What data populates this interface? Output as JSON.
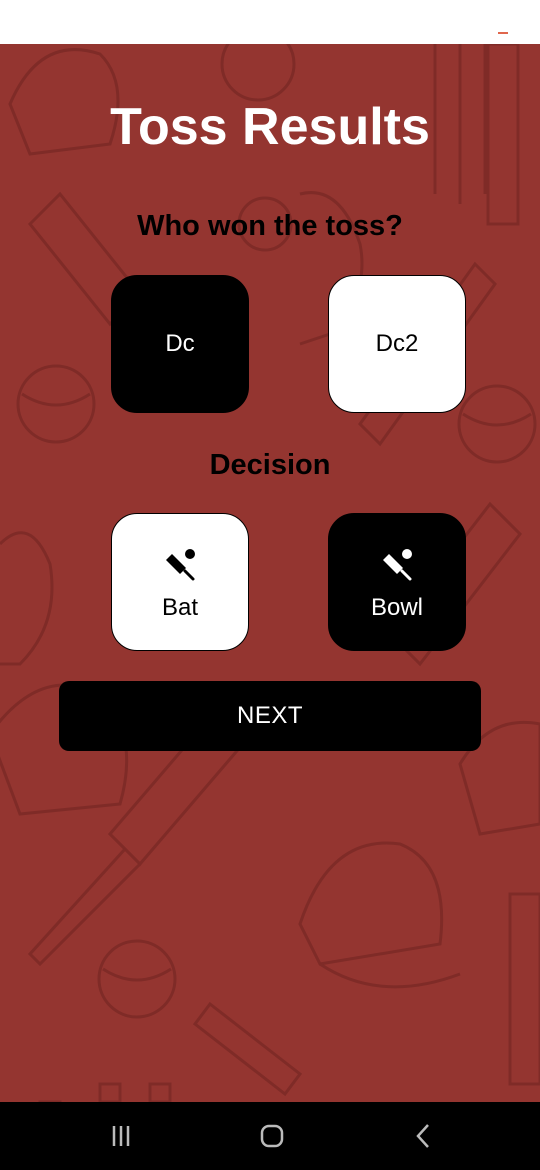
{
  "screen": {
    "title": "Toss Results",
    "toss_question": "Who won the toss?",
    "decision_label": "Decision"
  },
  "teams": [
    {
      "label": "Dc",
      "selected": true
    },
    {
      "label": "Dc2",
      "selected": false
    }
  ],
  "decisions": [
    {
      "label": "Bat",
      "icon": "cricket-bat-ball-icon",
      "selected": false
    },
    {
      "label": "Bowl",
      "icon": "cricket-bat-ball-icon",
      "selected": true
    }
  ],
  "next_button": {
    "label": "NEXT"
  },
  "nav_bar": {
    "recents_icon": "recent-apps-icon",
    "home_icon": "home-icon",
    "back_icon": "back-chevron-icon"
  },
  "colors": {
    "background": "#943530",
    "pattern": "#7f2b27",
    "selected_fill": "#000000",
    "unselected_fill": "#ffffff",
    "button": "#000000"
  }
}
